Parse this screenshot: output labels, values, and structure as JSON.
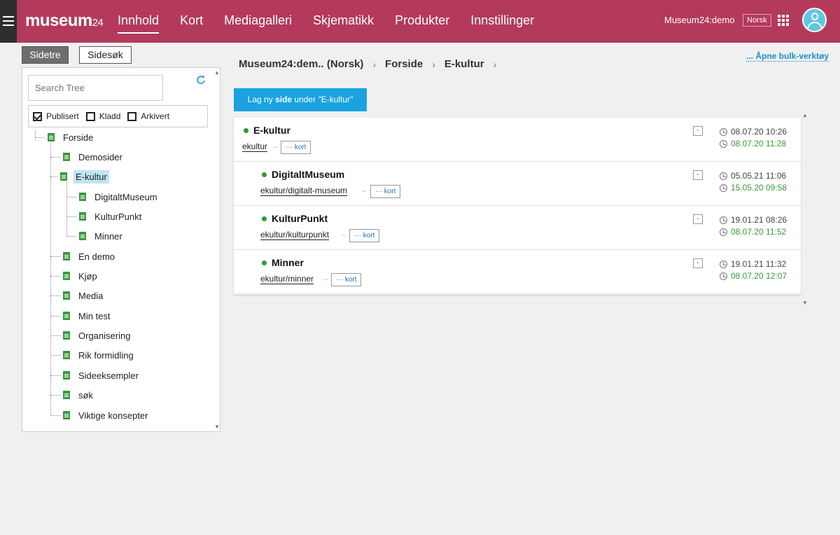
{
  "header": {
    "logo": "museum",
    "logo_suffix": "24",
    "nav": [
      "Innhold",
      "Kort",
      "Mediagalleri",
      "Skjematikk",
      "Produkter",
      "Innstillinger"
    ],
    "account": "Museum24:demo",
    "language": "Norsk",
    "colors": {
      "bar": "#b33a5b",
      "menu": "#2e2e2e"
    }
  },
  "left_tabs": {
    "tree": "Sidetre",
    "search": "Sidesøk"
  },
  "tree_panel": {
    "search_placeholder": "Search Tree",
    "filters": [
      {
        "label": "Publisert",
        "checked": true
      },
      {
        "label": "Kladd",
        "checked": false
      },
      {
        "label": "Arkivert",
        "checked": false
      }
    ],
    "root": "Forside",
    "items": [
      "Demosider",
      "E-kultur",
      "DigitaltMuseum",
      "KulturPunkt",
      "Minner",
      "En demo",
      "Kjøp",
      "Media",
      "Min test",
      "Organisering",
      "Rik formidling",
      "Sideeksempler",
      "søk",
      "Viktige konsepter"
    ],
    "selected": "E-kultur"
  },
  "breadcrumb": [
    "Museum24:dem.. (Norsk)",
    "Forside",
    "E-kultur"
  ],
  "bulk_link": "... Åpne bulk-verktøy",
  "new_page_button": {
    "prefix": "Lag ny ",
    "bold": "side",
    "suffix": " under \"E-kultur\""
  },
  "pages": [
    {
      "title": "E-kultur",
      "url": "ekultur",
      "kort": "kort",
      "created": "08.07.20 10:26",
      "modified": "08.07.20 11:28"
    },
    {
      "title": "DigitaltMuseum",
      "url": "ekultur/digitalt-museum",
      "kort": "kort",
      "created": "05.05.21 11:06",
      "modified": "15.05.20 09:58"
    },
    {
      "title": "KulturPunkt",
      "url": "ekultur/kulturpunkt",
      "kort": "kort",
      "created": "19.01.21 08:26",
      "modified": "08.07.20 11:52"
    },
    {
      "title": "Minner",
      "url": "ekultur/minner",
      "kort": "kort",
      "created": "19.01.21 11:32",
      "modified": "08.07.20 12:07"
    }
  ],
  "minus_label": "-",
  "kort_dots": "···"
}
